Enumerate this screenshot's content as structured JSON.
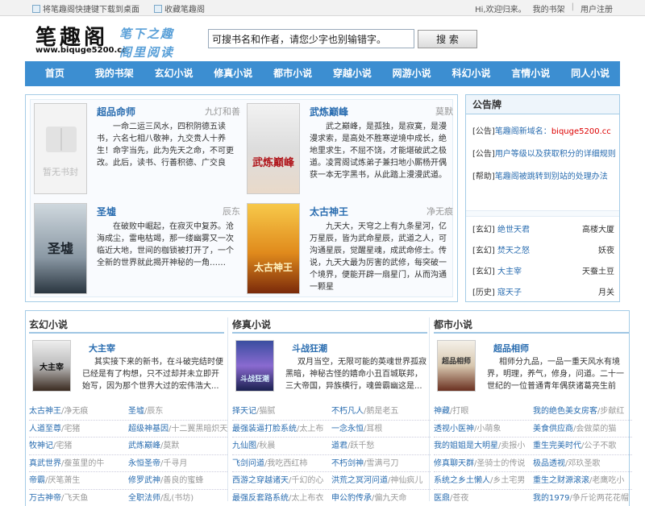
{
  "topbar": {
    "shortcut": "将笔趣阁快捷键下载到桌面",
    "bookmark": "收藏笔趣阁",
    "welcome": "Hi,欢迎归来。",
    "my_shelf": "我的书架",
    "separator": "|",
    "user_register": "用户注册"
  },
  "header": {
    "logo": "笔趣阁",
    "url": "www.biquge5200.cc",
    "slogan_top": "笔下之趣",
    "slogan_bottom": "阁里阅读",
    "search_placeholder": "可搜书名和作者，请您少字也别输错字。",
    "search_button": "搜 索"
  },
  "nav": [
    "首页",
    "我的书架",
    "玄幻小说",
    "修真小说",
    "都市小说",
    "穿越小说",
    "网游小说",
    "科幻小说",
    "言情小说",
    "同人小说"
  ],
  "hot_books": [
    {
      "title": "超品命师",
      "author": "九灯和善",
      "cover_text": "暂无书封",
      "desc": "一命二运三风水，四积阴德五读书，六名七相八敬神，九交贵人十养生！命字当先，此为先天之命，不可更改。此后，读书、行善积德、广交良"
    },
    {
      "title": "武炼巅峰",
      "author": "莫默",
      "cover_text": "武炼巅峰",
      "desc": "武之巅峰，是孤独，是寂寞，是漫漫求索，是高处不胜寒逆境中成长，绝地里求生，不屈不饶，才能堪破武之极道。凌霄阁试炼弟子兼扫地小厮杨开偶获一本无字黑书，从此踏上漫漫武道。"
    },
    {
      "title": "圣墟",
      "author": "辰东",
      "cover_text": "圣墟",
      "desc": "在破败中崛起，在寂灭中复苏。沧海成尘，雷电枯竭，那一缕幽雾又一次临近大地，世间的枷锁被打开了，一个全新的世界就此揭开神秘的一角……"
    },
    {
      "title": "太古神王",
      "author": "净无痕",
      "cover_text": "太古神王",
      "desc": "九天大，天穹之上有九条星河，亿万星辰，皆为武命星辰，武道之人，可沟通星辰，觉醒星魂，成武命修士。传说，九天大最为厉害的武修，每突破一个境界，便能开辟一扇星门，从而沟通一颗星"
    }
  ],
  "notice": {
    "title": "公告牌",
    "items": [
      {
        "tag": "[公告]",
        "text": "笔趣阁新域名：",
        "highlight": "biquge5200.cc"
      },
      {
        "tag": "[公告]",
        "text": "用户等级以及获取积分的详细规则",
        "highlight": ""
      },
      {
        "tag": "[帮助]",
        "text": "笔趣阁被跳转到别站的处理办法",
        "highlight": ""
      }
    ],
    "rec": [
      {
        "tag": "[玄幻]",
        "name": "绝世天君",
        "author": "高楼大厦"
      },
      {
        "tag": "[玄幻]",
        "name": "焚天之怒",
        "author": "妖夜"
      },
      {
        "tag": "[玄幻]",
        "name": "大主宰",
        "author": "天蚕土豆"
      },
      {
        "tag": "[历史]",
        "name": "寇天子",
        "author": "月关"
      }
    ]
  },
  "categories": [
    {
      "title": "玄幻小说",
      "book": {
        "title": "大主宰",
        "cover_text": "大主宰",
        "desc": "其实接下来的新书，在斗破完结时便已经是有了构想，只不过却并未立即开始写，因为那个世界大过的宏伟浩大..."
      },
      "rows": [
        [
          {
            "n": "太古神王",
            "a": "净无痕"
          },
          {
            "n": "圣墟",
            "a": "辰东"
          }
        ],
        [
          {
            "n": "人道至尊",
            "a": "宅猪"
          },
          {
            "n": "超级神基因",
            "a": "十二翼黑暗炽天"
          }
        ],
        [
          {
            "n": "牧神记",
            "a": "宅猪"
          },
          {
            "n": "武炼巅峰",
            "a": "莫默"
          }
        ],
        [
          {
            "n": "真武世界",
            "a": "蚕茧里的牛"
          },
          {
            "n": "永恒圣帝",
            "a": "千寻月"
          }
        ],
        [
          {
            "n": "帝霸",
            "a": "厌笔萧生"
          },
          {
            "n": "修罗武神",
            "a": "善良的蜜蜂"
          }
        ],
        [
          {
            "n": "万古神帝",
            "a": "飞天鱼"
          },
          {
            "n": "全职法师",
            "a": "乱(书坊)"
          }
        ]
      ]
    },
    {
      "title": "修真小说",
      "book": {
        "title": "斗战狂潮",
        "cover_text": "斗战狂潮",
        "desc": "双月当空，无限可能的英魂世界孤寂黑暗，神秘古怪的嬉命小丑百城联邦，三大帝国，异族横行，魂兽霸幽这是..."
      },
      "rows": [
        [
          {
            "n": "择天记",
            "a": "猫腻"
          },
          {
            "n": "不朽凡人",
            "a": "鹅是老五"
          }
        ],
        [
          {
            "n": "最强装逼打脸系统",
            "a": "太上布"
          },
          {
            "n": "一念永恒",
            "a": "耳根"
          }
        ],
        [
          {
            "n": "九仙图",
            "a": "秋晨"
          },
          {
            "n": "道君",
            "a": "跃千愁"
          }
        ],
        [
          {
            "n": "飞剑问道",
            "a": "我吃西红柿"
          },
          {
            "n": "不朽剑神",
            "a": "雪满弓刀"
          }
        ],
        [
          {
            "n": "西游之穿越诸天",
            "a": "千幻的心"
          },
          {
            "n": "洪荒之冥河问道",
            "a": "神仙疯儿"
          }
        ],
        [
          {
            "n": "最强反套路系统",
            "a": "太上布衣"
          },
          {
            "n": "申公豹传承",
            "a": "偏九天命"
          }
        ]
      ]
    },
    {
      "title": "都市小说",
      "book": {
        "title": "超品相师",
        "cover_text": "超品相师",
        "desc": "相师分九品，一品一重天风水有境界，明理，养气，修身，问道。二十一世纪的一位普通青年偶获诸葛亮生前的..."
      },
      "rows": [
        [
          {
            "n": "神藏",
            "a": "打眼"
          },
          {
            "n": "我的绝色美女房客",
            "a": "步献红"
          }
        ],
        [
          {
            "n": "透视小医神",
            "a": "小萌象"
          },
          {
            "n": "美食供应商",
            "a": "会做菜的猫"
          }
        ],
        [
          {
            "n": "我的姐姐是大明星",
            "a": "卖报小"
          },
          {
            "n": "重生完美时代",
            "a": "公子不歌"
          }
        ],
        [
          {
            "n": "修真聊天群",
            "a": "圣骑士的传说"
          },
          {
            "n": "极品透视",
            "a": "邓玖圣歌"
          }
        ],
        [
          {
            "n": "系统之乡土懒人",
            "a": "乡土宅男"
          },
          {
            "n": "重生之财源滚滚",
            "a": "老鹰吃小"
          }
        ],
        [
          {
            "n": "医鼎",
            "a": "苍夜"
          },
          {
            "n": "我的1979",
            "a": "争斤论两花花帽"
          }
        ]
      ]
    }
  ],
  "colors": {
    "accent": "#3c8ed1",
    "link": "#2a6db0",
    "border": "#a5cce6",
    "highlight": "#dd0000"
  }
}
